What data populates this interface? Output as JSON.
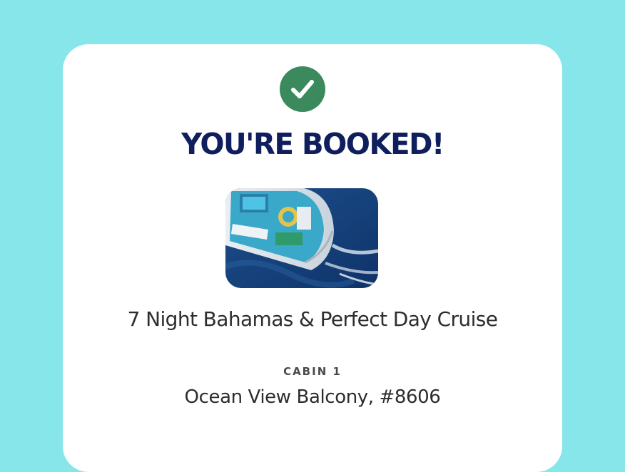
{
  "confirmation": {
    "status_icon": "check-circle-icon",
    "title": "YOU'RE BOOKED!",
    "cruise_name": "7 Night Bahamas & Perfect Day Cruise",
    "cabin": {
      "label": "CABIN 1",
      "value": "Ocean View Balcony, #8606"
    }
  },
  "colors": {
    "background": "#86e6ea",
    "card": "#ffffff",
    "check": "#3b8a5e",
    "title": "#0f1e5c",
    "text": "#2d2d2d"
  }
}
